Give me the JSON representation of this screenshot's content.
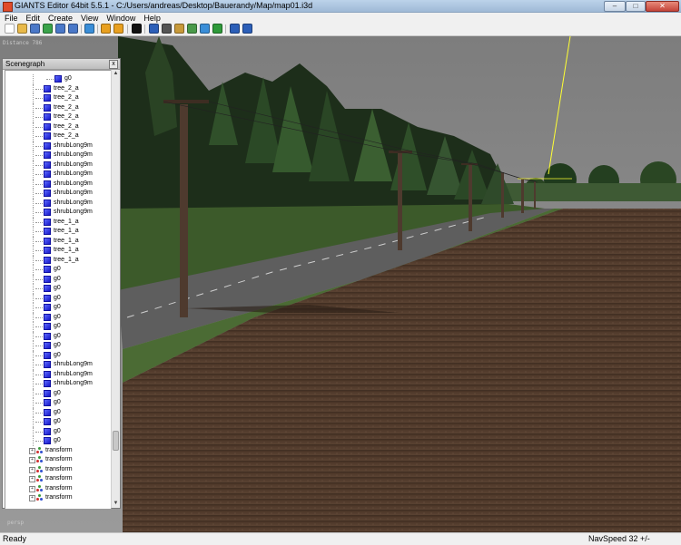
{
  "window": {
    "title": "GIANTS Editor 64bit 5.5.1 - C:/Users/andreas/Desktop/Bauerandy/Map/map01.i3d",
    "minimize": "–",
    "maximize": "□",
    "close": "✕"
  },
  "menu": [
    "File",
    "Edit",
    "Create",
    "View",
    "Window",
    "Help"
  ],
  "toolbar": [
    {
      "icon": "new-file-icon",
      "color": "#ffffff"
    },
    {
      "icon": "open-folder-icon",
      "color": "#e8b949"
    },
    {
      "icon": "save-icon",
      "color": "#4a78c8"
    },
    {
      "icon": "reload-icon",
      "color": "#3aa34a"
    },
    {
      "icon": "export-icon",
      "color": "#4a78c8"
    },
    {
      "icon": "save-as-icon",
      "color": "#4a78c8"
    },
    {
      "icon": "import-icon",
      "color": "#3a8ed8"
    },
    {
      "icon": "undo-icon",
      "color": "#e8a020"
    },
    {
      "icon": "redo-icon",
      "color": "#e8a020"
    },
    {
      "icon": "play-icon",
      "color": "#111111"
    },
    {
      "icon": "select-icon",
      "color": "#2c5fb8"
    },
    {
      "icon": "move-icon",
      "color": "#555555"
    },
    {
      "icon": "terrain-paint-icon",
      "color": "#c89a3a"
    },
    {
      "icon": "terrain-sculpt-icon",
      "color": "#4a9a4a"
    },
    {
      "icon": "foliage-paint-icon",
      "color": "#3a8ed8"
    },
    {
      "icon": "decal-icon",
      "color": "#2f9a3a"
    },
    {
      "icon": "settings-icon",
      "color": "#2c5fb8"
    },
    {
      "icon": "gear-icon",
      "color": "#2c5fb8"
    }
  ],
  "viewport": {
    "distance_label": "Distance 786",
    "camera_label": "persp"
  },
  "scenegraph": {
    "title": "Scenegraph",
    "close": "x",
    "nodes": [
      {
        "label": "g0",
        "type": "shape",
        "depth": 2
      },
      {
        "label": "tree_2_a",
        "type": "shape",
        "depth": 1
      },
      {
        "label": "tree_2_a",
        "type": "shape",
        "depth": 1
      },
      {
        "label": "tree_2_a",
        "type": "shape",
        "depth": 1
      },
      {
        "label": "tree_2_a",
        "type": "shape",
        "depth": 1
      },
      {
        "label": "tree_2_a",
        "type": "shape",
        "depth": 1
      },
      {
        "label": "tree_2_a",
        "type": "shape",
        "depth": 1
      },
      {
        "label": "shrubLong9m",
        "type": "shape",
        "depth": 1
      },
      {
        "label": "shrubLong9m",
        "type": "shape",
        "depth": 1
      },
      {
        "label": "shrubLong9m",
        "type": "shape",
        "depth": 1
      },
      {
        "label": "shrubLong9m",
        "type": "shape",
        "depth": 1
      },
      {
        "label": "shrubLong9m",
        "type": "shape",
        "depth": 1
      },
      {
        "label": "shrubLong9m",
        "type": "shape",
        "depth": 1
      },
      {
        "label": "shrubLong9m",
        "type": "shape",
        "depth": 1
      },
      {
        "label": "shrubLong9m",
        "type": "shape",
        "depth": 1
      },
      {
        "label": "tree_1_a",
        "type": "shape",
        "depth": 1
      },
      {
        "label": "tree_1_a",
        "type": "shape",
        "depth": 1
      },
      {
        "label": "tree_1_a",
        "type": "shape",
        "depth": 1
      },
      {
        "label": "tree_1_a",
        "type": "shape",
        "depth": 1
      },
      {
        "label": "tree_1_a",
        "type": "shape",
        "depth": 1
      },
      {
        "label": "g0",
        "type": "shape",
        "depth": 1
      },
      {
        "label": "g0",
        "type": "shape",
        "depth": 1
      },
      {
        "label": "g0",
        "type": "shape",
        "depth": 1
      },
      {
        "label": "g0",
        "type": "shape",
        "depth": 1
      },
      {
        "label": "g0",
        "type": "shape",
        "depth": 1
      },
      {
        "label": "g0",
        "type": "shape",
        "depth": 1
      },
      {
        "label": "g0",
        "type": "shape",
        "depth": 1
      },
      {
        "label": "g0",
        "type": "shape",
        "depth": 1
      },
      {
        "label": "g0",
        "type": "shape",
        "depth": 1
      },
      {
        "label": "g0",
        "type": "shape",
        "depth": 1
      },
      {
        "label": "shrubLong9m",
        "type": "shape",
        "depth": 1
      },
      {
        "label": "shrubLong9m",
        "type": "shape",
        "depth": 1
      },
      {
        "label": "shrubLong9m",
        "type": "shape",
        "depth": 1
      },
      {
        "label": "g0",
        "type": "shape",
        "depth": 1
      },
      {
        "label": "g0",
        "type": "shape",
        "depth": 1
      },
      {
        "label": "g0",
        "type": "shape",
        "depth": 1
      },
      {
        "label": "g0",
        "type": "shape",
        "depth": 1
      },
      {
        "label": "g0",
        "type": "shape",
        "depth": 1
      },
      {
        "label": "g0",
        "type": "shape",
        "depth": 1
      },
      {
        "label": "transform",
        "type": "transform",
        "depth": 0
      },
      {
        "label": "transform",
        "type": "transform",
        "depth": 0
      },
      {
        "label": "transform",
        "type": "transform",
        "depth": 0
      },
      {
        "label": "transform",
        "type": "transform",
        "depth": 0
      },
      {
        "label": "transform",
        "type": "transform",
        "depth": 0
      },
      {
        "label": "transform",
        "type": "transform",
        "depth": 0
      }
    ]
  },
  "status": {
    "left": "Ready",
    "navspeed": "NavSpeed 32 +/-"
  }
}
